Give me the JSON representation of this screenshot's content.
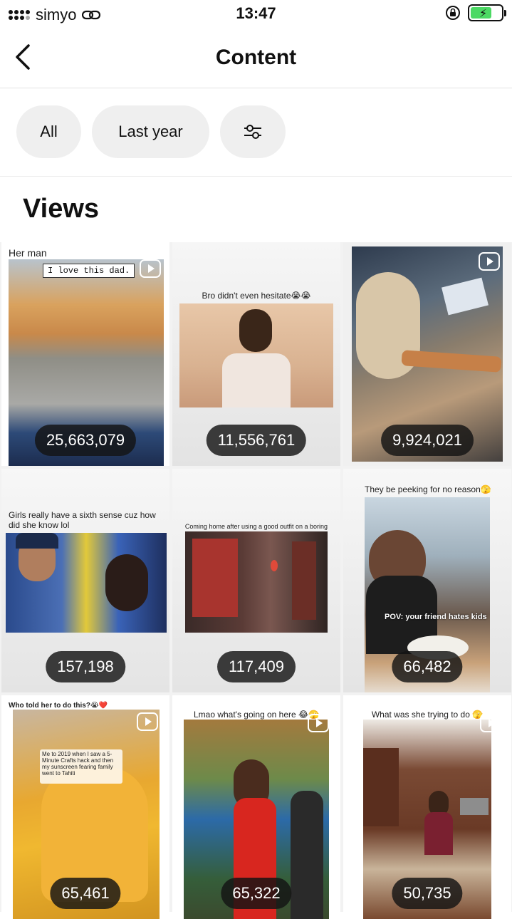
{
  "status": {
    "carrier": "simyo",
    "time": "13:47"
  },
  "nav": {
    "title": "Content"
  },
  "filters": {
    "all": "All",
    "period": "Last year"
  },
  "section": {
    "title": "Views"
  },
  "tiles": [
    {
      "caption": "Her man",
      "overlay": "I love this dad.",
      "views": "25,663,079"
    },
    {
      "caption": "Bro didn't even hesitate😭😭",
      "views": "11,556,761"
    },
    {
      "caption": "",
      "views": "9,924,021"
    },
    {
      "caption": "Girls really have a sixth sense cuz how did she know lol",
      "views": "157,198"
    },
    {
      "caption": "Coming home after using a good outfit on a boring day",
      "views": "117,409"
    },
    {
      "caption": "They be peeking for no reason🫣",
      "overlay": "POV: your friend hates kids",
      "views": "66,482"
    },
    {
      "caption": "Who told her to do this?😭❤️",
      "overlay": "Me to 2019 when I saw a 5-Minute Crafts hack and then my sunscreen fearing family went to Tahiti",
      "views": "65,461"
    },
    {
      "caption": "Lmao what's going on here 😂🫣",
      "views": "65,322"
    },
    {
      "caption": "What was she trying to do 🫣",
      "views": "50,735"
    }
  ],
  "colors": {
    "chip_bg": "#efefef",
    "badge_bg": "#141414",
    "battery": "#4cd964"
  }
}
